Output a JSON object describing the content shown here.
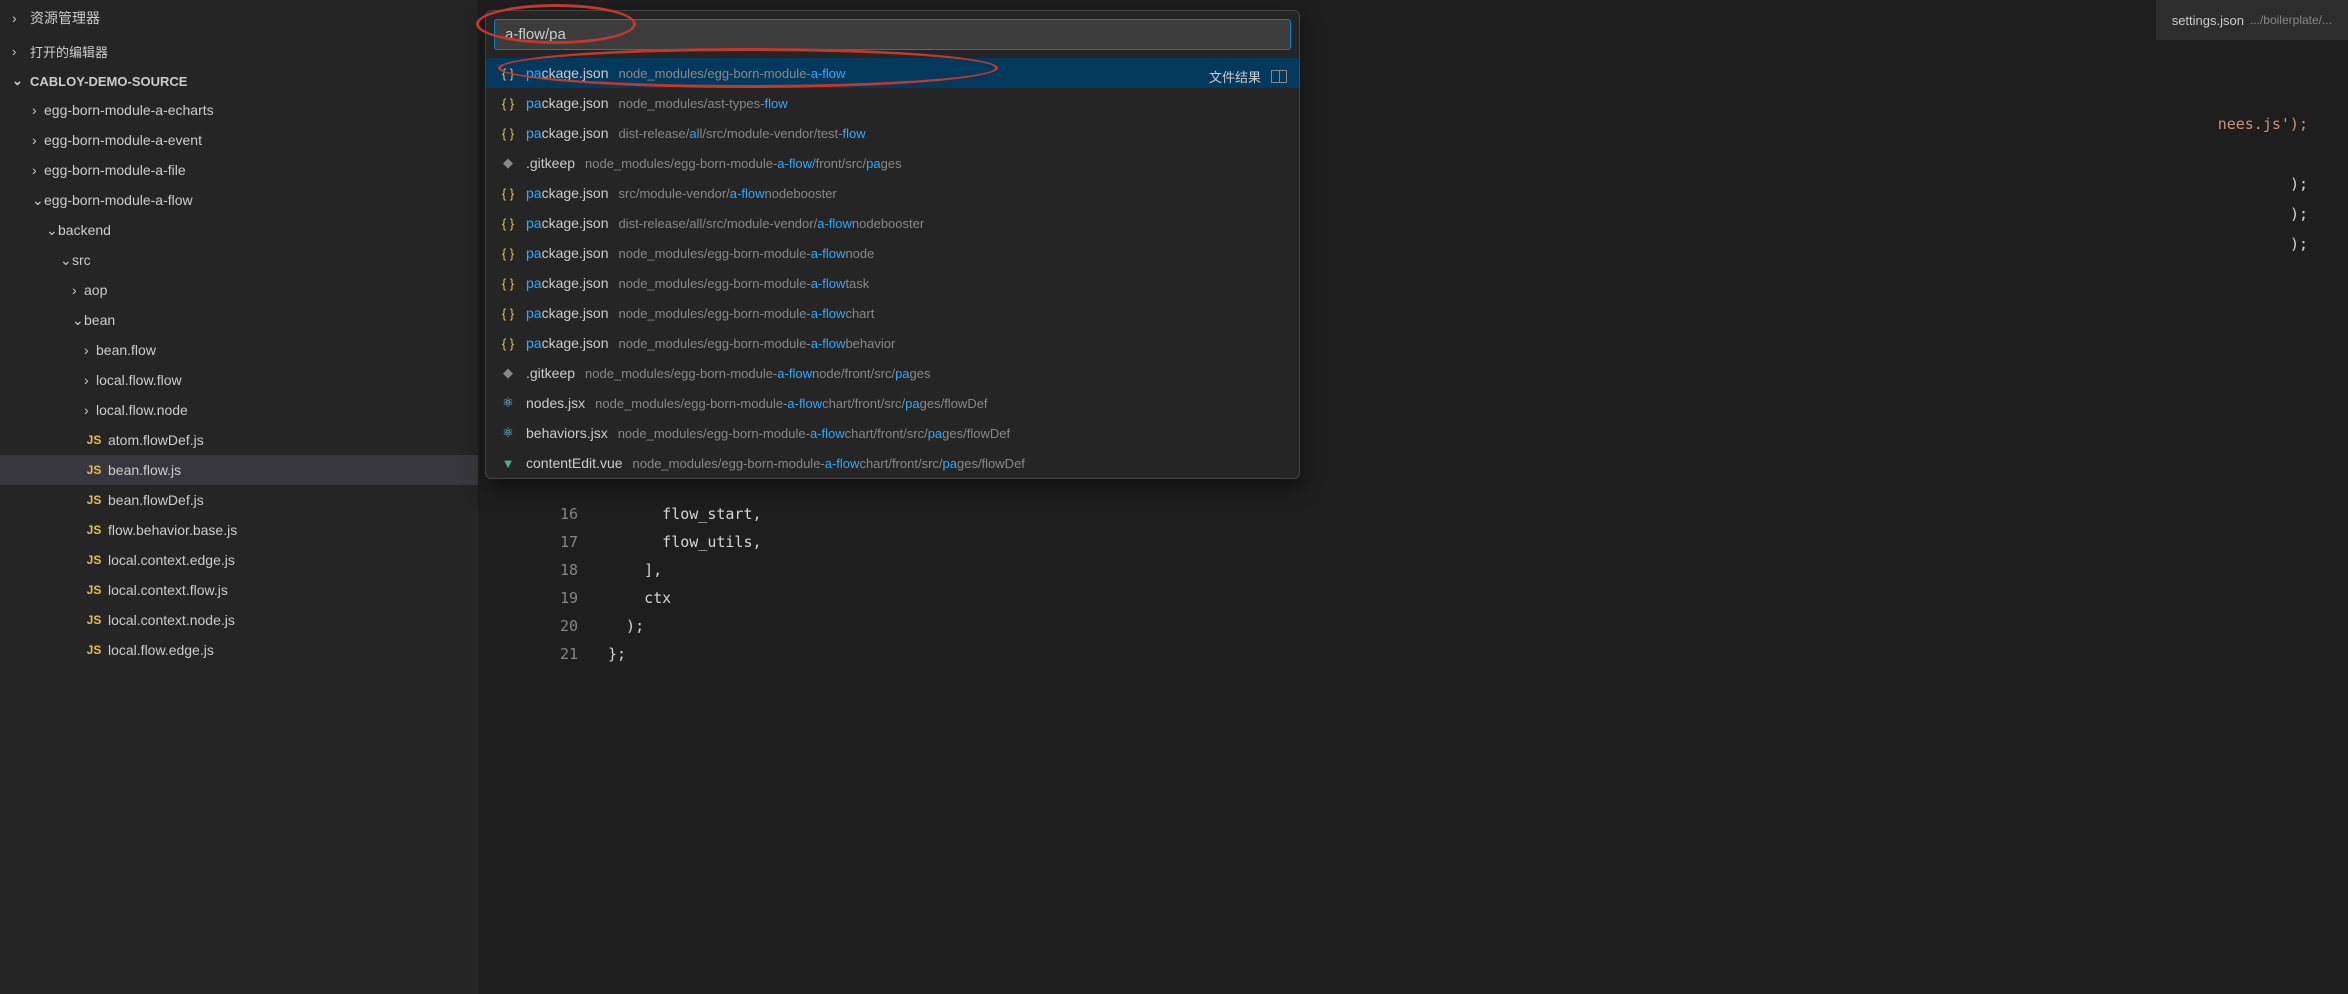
{
  "sidebar": {
    "explorer_title": "资源管理器",
    "open_editors": "打开的编辑器",
    "workspace": "CABLOY-DEMO-SOURCE",
    "tree": [
      {
        "type": "folder",
        "label": "egg-born-module-a-echarts",
        "indent": 32,
        "expanded": false
      },
      {
        "type": "folder",
        "label": "egg-born-module-a-event",
        "indent": 32,
        "expanded": false
      },
      {
        "type": "folder",
        "label": "egg-born-module-a-file",
        "indent": 32,
        "expanded": false
      },
      {
        "type": "folder",
        "label": "egg-born-module-a-flow",
        "indent": 32,
        "expanded": true
      },
      {
        "type": "folder",
        "label": "backend",
        "indent": 46,
        "expanded": true
      },
      {
        "type": "folder",
        "label": "src",
        "indent": 60,
        "expanded": true
      },
      {
        "type": "folder",
        "label": "aop",
        "indent": 72,
        "expanded": false
      },
      {
        "type": "folder",
        "label": "bean",
        "indent": 72,
        "expanded": true
      },
      {
        "type": "folder",
        "label": "bean.flow",
        "indent": 84,
        "expanded": false
      },
      {
        "type": "folder",
        "label": "local.flow.flow",
        "indent": 84,
        "expanded": false
      },
      {
        "type": "folder",
        "label": "local.flow.node",
        "indent": 84,
        "expanded": false
      },
      {
        "type": "js",
        "label": "atom.flowDef.js",
        "indent": 84
      },
      {
        "type": "js",
        "label": "bean.flow.js",
        "indent": 84,
        "selected": true
      },
      {
        "type": "js",
        "label": "bean.flowDef.js",
        "indent": 84
      },
      {
        "type": "js",
        "label": "flow.behavior.base.js",
        "indent": 84
      },
      {
        "type": "js",
        "label": "local.context.edge.js",
        "indent": 84
      },
      {
        "type": "js",
        "label": "local.context.flow.js",
        "indent": 84
      },
      {
        "type": "js",
        "label": "local.context.node.js",
        "indent": 84
      },
      {
        "type": "js",
        "label": "local.flow.edge.js",
        "indent": 84
      }
    ]
  },
  "tab": {
    "name": "settings.json",
    "path": ".../boilerplate/..."
  },
  "editor": {
    "fragment_right": "nees.js');",
    "lines": [
      {
        "num": "",
        "text": ");"
      },
      {
        "num": "",
        "text": ");"
      },
      {
        "num": "",
        "text": ");"
      },
      {
        "num": "16",
        "text": "      flow_start,"
      },
      {
        "num": "17",
        "text": "      flow_utils,"
      },
      {
        "num": "18",
        "text": "    ],"
      },
      {
        "num": "19",
        "text": "    ctx"
      },
      {
        "num": "20",
        "text": "  );"
      },
      {
        "num": "21",
        "text": "};"
      }
    ]
  },
  "quickopen": {
    "input_value": "a-flow/pa",
    "footer_text": "文件结果",
    "results": [
      {
        "icon": "json",
        "name_parts": [
          "pa",
          "ckage.json"
        ],
        "path_pre": "node_modules/egg-born-module-",
        "path_hl": "a-flow",
        "path_post": "",
        "selected": true
      },
      {
        "icon": "json",
        "name_parts": [
          "pa",
          "ckage.json"
        ],
        "path_pre": "node_modules/ast-types-",
        "path_hl": "flow",
        "path_post": ""
      },
      {
        "icon": "json",
        "name_parts": [
          "pa",
          "ckage.json"
        ],
        "path_pre": "dist-release/",
        "path_hl": "a",
        "path_mid": "ll/src/module-vendor/test-",
        "path_hl2": "flow",
        "path_post": ""
      },
      {
        "icon": "git",
        "name_plain": ".gitkeep",
        "path_pre": "node_modules/egg-born-module-",
        "path_hl": "a-flow/",
        "path_mid": "front/src/",
        "path_hl2": "pa",
        "path_post": "ges"
      },
      {
        "icon": "json",
        "name_parts": [
          "pa",
          "ckage.json"
        ],
        "path_pre": "src/module-vendor/",
        "path_hl": "a-flow",
        "path_post": "nodebooster"
      },
      {
        "icon": "json",
        "name_parts": [
          "pa",
          "ckage.json"
        ],
        "path_pre": "dist-release/all/src/module-vendor/",
        "path_hl": "a-flow",
        "path_post": "nodebooster"
      },
      {
        "icon": "json",
        "name_parts": [
          "pa",
          "ckage.json"
        ],
        "path_pre": "node_modules/egg-born-module-",
        "path_hl": "a-flow",
        "path_post": "node"
      },
      {
        "icon": "json",
        "name_parts": [
          "pa",
          "ckage.json"
        ],
        "path_pre": "node_modules/egg-born-module-",
        "path_hl": "a-flow",
        "path_post": "task"
      },
      {
        "icon": "json",
        "name_parts": [
          "pa",
          "ckage.json"
        ],
        "path_pre": "node_modules/egg-born-module-",
        "path_hl": "a-flow",
        "path_post": "chart"
      },
      {
        "icon": "json",
        "name_parts": [
          "pa",
          "ckage.json"
        ],
        "path_pre": "node_modules/egg-born-module-",
        "path_hl": "a-flow",
        "path_post": "behavior"
      },
      {
        "icon": "git",
        "name_plain": ".gitkeep",
        "path_pre": "node_modules/egg-born-module-",
        "path_hl": "a-flow",
        "path_mid": "node/front/src/",
        "path_hl2": "pa",
        "path_post": "ges"
      },
      {
        "icon": "react",
        "name_plain": "nodes.jsx",
        "path_pre": "node_modules/egg-born-module-",
        "path_hl": "a-flow",
        "path_mid": "chart/front/src/",
        "path_hl2": "pa",
        "path_post": "ges/flowDef"
      },
      {
        "icon": "react",
        "name_plain": "behaviors.jsx",
        "path_pre": "node_modules/egg-born-module-",
        "path_hl": "a-flow",
        "path_mid": "chart/front/src/",
        "path_hl2": "pa",
        "path_post": "ges/flowDef"
      },
      {
        "icon": "vue",
        "name_plain": "contentEdit.vue",
        "path_pre": "node_modules/egg-born-module-",
        "path_hl": "a-flow",
        "path_mid": "chart/front/src/",
        "path_hl2": "pa",
        "path_post": "ges/flowDef"
      }
    ]
  }
}
